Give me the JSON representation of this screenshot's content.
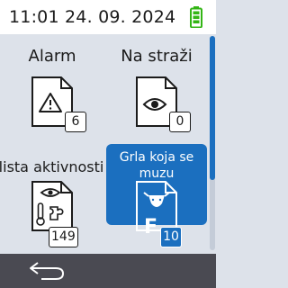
{
  "status": {
    "time": "11:01",
    "date": "24. 09. 2024",
    "battery_icon": "battery-full-icon",
    "battery_color": "#33b515"
  },
  "tiles": [
    {
      "label": "Alarm",
      "icon": "warning-document-icon",
      "count": "6"
    },
    {
      "label": "Na straži",
      "icon": "eye-document-icon",
      "count": "0"
    },
    {
      "label": "lista aktivnosti",
      "icon": "activity-document-icon",
      "count": "149"
    },
    {
      "label": "Grla koja se muzu",
      "icon": "cow-document-icon",
      "letter": "F",
      "count": "10",
      "selected": true
    }
  ],
  "nav": {
    "back_icon": "back-arrow-icon"
  },
  "colors": {
    "accent": "#1b6fbf",
    "background": "#dde2ea",
    "bottom_bar": "#4a4a52"
  }
}
